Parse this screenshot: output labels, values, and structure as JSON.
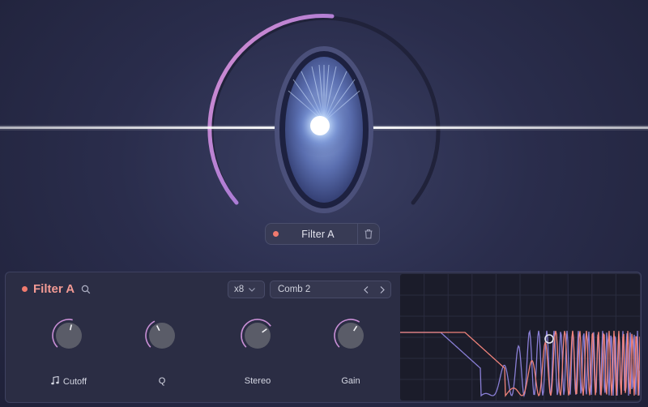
{
  "hero": {
    "module_name": "Filter A"
  },
  "panel": {
    "title": "Filter A",
    "multiplier": "x8",
    "preset": "Comb 2",
    "knobs": [
      {
        "id": "cutoff",
        "label": "Cutoff",
        "value": 0.55,
        "has_icon": true
      },
      {
        "id": "q",
        "label": "Q",
        "value": 0.4,
        "has_icon": false
      },
      {
        "id": "stereo",
        "label": "Stereo",
        "value": 0.7,
        "has_icon": false
      },
      {
        "id": "gain",
        "label": "Gain",
        "value": 0.62,
        "has_icon": false
      }
    ]
  },
  "colors": {
    "accent": "#f07a6e",
    "title": "#f29a94",
    "curve_a": "#f0837a",
    "curve_b": "#8a7fd6",
    "arc": "#c98fd6"
  },
  "hero_arc_value": 0.5
}
